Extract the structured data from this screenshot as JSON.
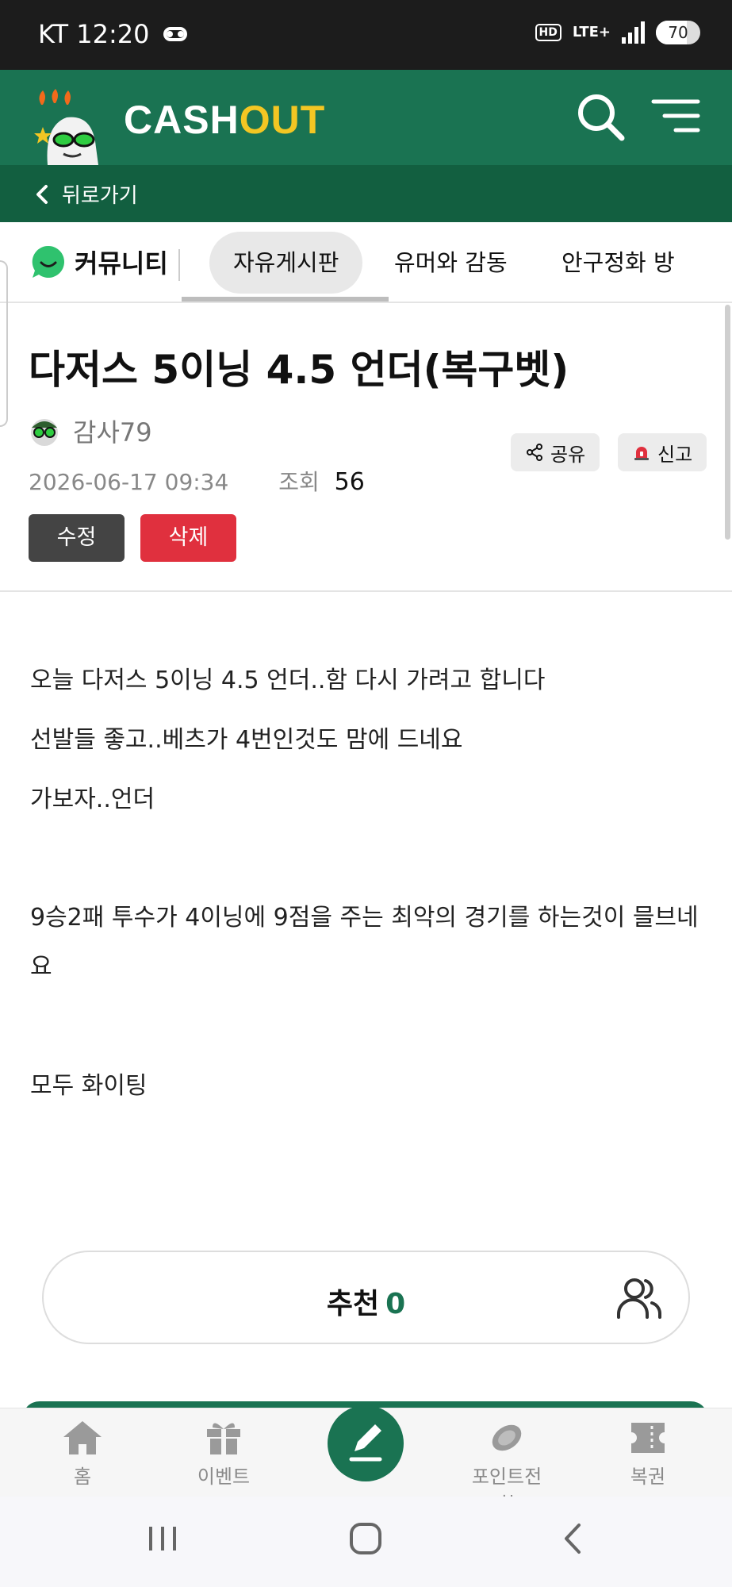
{
  "status_bar": {
    "carrier_time": "KT 12:20",
    "network": "LTE+",
    "hd": "HD",
    "battery": "70",
    "battery_level": 0.7,
    "icons": [
      "voicemail-icon",
      "hd-icon",
      "lte-icon",
      "signal-icon",
      "battery-icon"
    ]
  },
  "header": {
    "logo_cash": "CASH",
    "logo_out": "OUT",
    "icons": [
      "mascot-logo",
      "search-icon",
      "menu-icon"
    ],
    "colors": {
      "brand_green": "#1a7352",
      "dark_green": "#125f40",
      "logo_yellow": "#f3c623"
    }
  },
  "back_bar": {
    "label": "뒤로가기"
  },
  "community": {
    "label": "커뮤니티",
    "tabs": [
      {
        "label": "자유게시판",
        "active": true
      },
      {
        "label": "유머와 감동",
        "active": false
      },
      {
        "label": "안구정화 방",
        "active": false
      }
    ]
  },
  "post": {
    "title": "다저스 5이닝 4.5 언더(복구벳)",
    "author": "감사79",
    "datetime": "2026-06-17 09:34",
    "views_label": "조회",
    "views": "56",
    "share_label": "공유",
    "report_label": "신고",
    "edit_label": "수정",
    "delete_label": "삭제",
    "body": [
      "오늘 다저스 5이닝 4.5 언더..함 다시 가려고 합니다",
      "선발들 좋고..베츠가 4번인것도 맘에 드네요",
      "가보자..언더",
      "",
      "9승2패 투수가 4이닝에 9점을 주는 최악의 경기를 하는것이 믈브네요",
      "",
      "모두 화이팅"
    ]
  },
  "recommend": {
    "label": "추천",
    "count": "0"
  },
  "bottom_nav": {
    "items": [
      {
        "label": "홈",
        "icon": "home-icon"
      },
      {
        "label": "이벤트",
        "icon": "gift-icon"
      },
      {
        "label": "",
        "icon": "pencil-icon"
      },
      {
        "label": "포인트전환",
        "icon": "coin-icon"
      },
      {
        "label": "복권",
        "icon": "ticket-icon"
      }
    ]
  },
  "system_nav": {
    "icons": [
      "recents-icon",
      "home-circle-icon",
      "back-icon"
    ]
  }
}
